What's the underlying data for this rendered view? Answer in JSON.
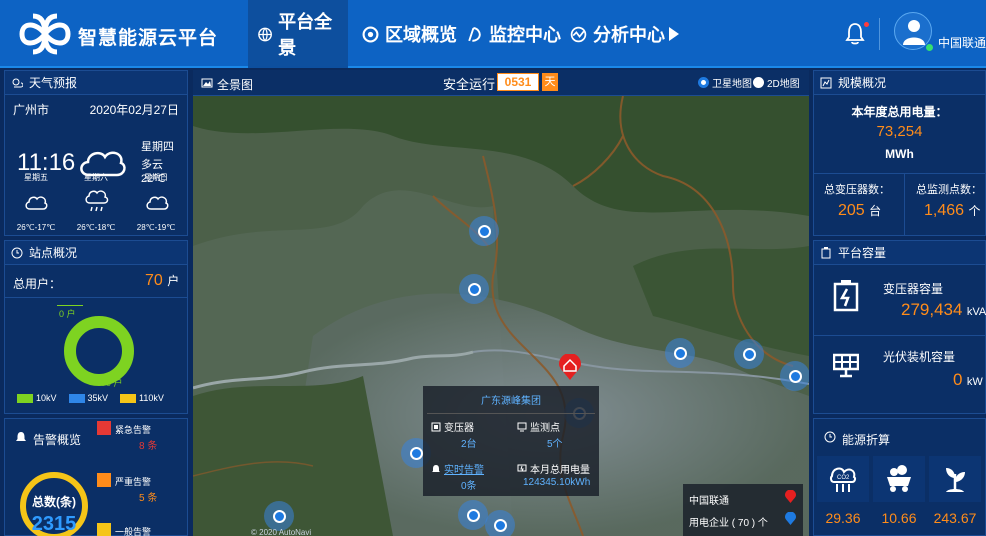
{
  "header": {
    "brand": "智慧能源云平台",
    "tabs": [
      {
        "label": "平台全景",
        "icon": "globe-icon",
        "active": true
      },
      {
        "label": "区域概览",
        "icon": "region-icon",
        "active": false
      },
      {
        "label": "监控中心",
        "icon": "monitor-icon",
        "active": false
      },
      {
        "label": "分析中心",
        "icon": "analysis-icon",
        "active": false
      }
    ],
    "user": "中国联通"
  },
  "weather": {
    "title": "天气预报",
    "city": "广州市",
    "date": "2020年02月27日",
    "time": "11:16",
    "weekday": "星期四",
    "condition": "多云",
    "temp_now": "22℃",
    "forecast": [
      {
        "day": "星期五",
        "range": "26℃-17℃",
        "icon": "cloud-icon"
      },
      {
        "day": "星期六",
        "range": "26℃-18℃",
        "icon": "rain-cloud-icon"
      },
      {
        "day": "星期日",
        "range": "28℃-19℃",
        "icon": "cloud-icon"
      }
    ]
  },
  "stations": {
    "title": "站点概况",
    "total_label": "总用户：",
    "total_value": "70",
    "unit": "户",
    "donut_label_top": "0 户",
    "donut_label_bottom": "70 户",
    "legend": [
      {
        "label": "10kV",
        "color": "#7ed321"
      },
      {
        "label": "35kV",
        "color": "#2f86e8"
      },
      {
        "label": "110kV",
        "color": "#f5c518"
      }
    ]
  },
  "alarms": {
    "title": "告警概览",
    "total_label": "总数(条)",
    "total_value": "2315",
    "items": [
      {
        "label": "紧急告警",
        "value": "8 条",
        "color": "#e53935"
      },
      {
        "label": "严重告警",
        "value": "5 条",
        "color": "#ff8c1a"
      },
      {
        "label": "一般告警",
        "value": "",
        "color": "#f5c518"
      }
    ]
  },
  "map": {
    "title": "全景图",
    "safe_label": "安全运行",
    "safe_days": "0531",
    "safe_unit": "天",
    "mode_sat": "卫星地图",
    "mode_2d": "2D地图",
    "copyright": "© 2020 AutoNavi",
    "popup": {
      "title": "广东源峰集团",
      "transformer_label": "变压器",
      "transformer_value": "2台",
      "monitor_label": "监测点",
      "monitor_value": "5个",
      "alarm_label": "实时告警",
      "alarm_value": "0条",
      "power_label": "本月总用电量",
      "power_value": "124345.10kWh"
    },
    "legend": {
      "company": "中国联通",
      "enterprise": "用电企业 ( 70 ) 个"
    }
  },
  "scale": {
    "title": "规模概况",
    "annual_label": "本年度总用电量：",
    "annual_value": "73,254",
    "annual_unit": "MWh",
    "transformer_label": "总变压器数：",
    "transformer_value": "205",
    "transformer_unit": "台",
    "monitor_label": "总监测点数：",
    "monitor_value": "1,466",
    "monitor_unit": "个"
  },
  "capacity": {
    "title": "平台容量",
    "transformer_label": "变压器容量",
    "transformer_value": "279,434",
    "transformer_unit": "kVA",
    "pv_label": "光伏装机容量",
    "pv_value": "0",
    "pv_unit": "kW"
  },
  "energy": {
    "title": "能源折算",
    "items": [
      {
        "icon": "co2-icon",
        "value": "29.36"
      },
      {
        "icon": "coal-icon",
        "value": "10.66"
      },
      {
        "icon": "tree-icon",
        "value": "243.67"
      }
    ]
  }
}
